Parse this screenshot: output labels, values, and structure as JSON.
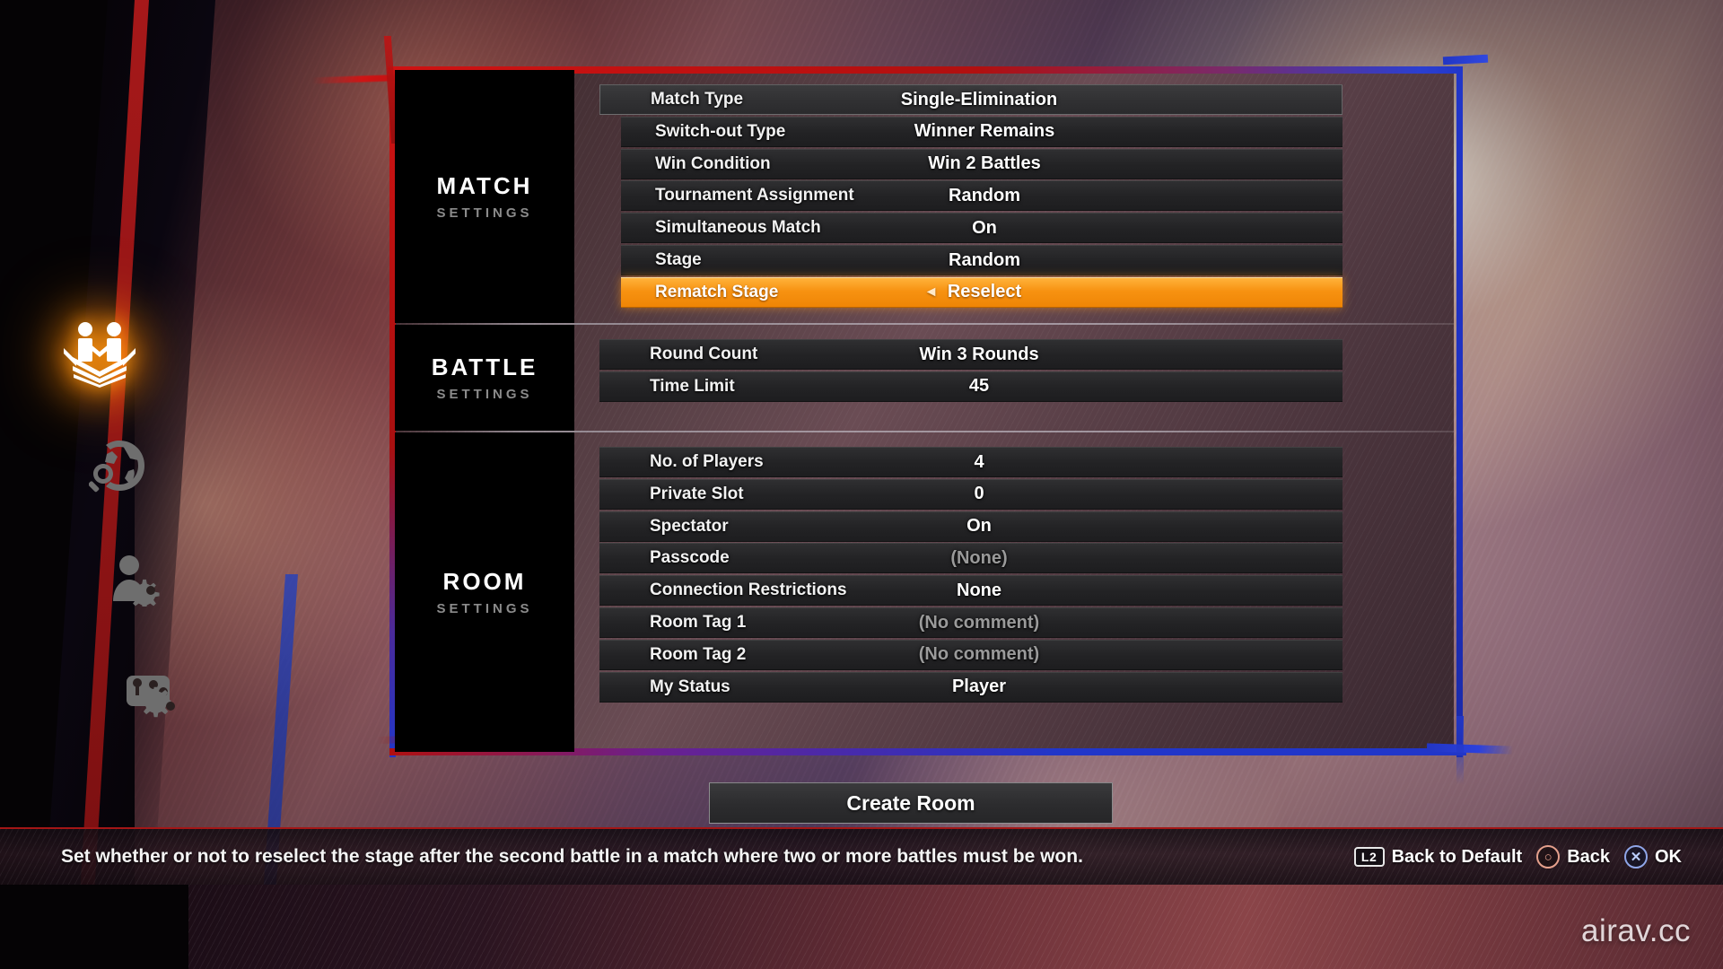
{
  "sidebar": {
    "items": [
      {
        "name": "create-room",
        "icon": "ring-room-icon",
        "active": true
      },
      {
        "name": "search-rooms",
        "icon": "globe-search-icon",
        "active": false
      },
      {
        "name": "player-settings",
        "icon": "player-gear-icon",
        "active": false
      },
      {
        "name": "controller-settings",
        "icon": "controller-gear-icon",
        "active": false
      }
    ]
  },
  "sections": [
    {
      "title": "MATCH",
      "subtitle": "SETTINGS",
      "rows": [
        {
          "label": "Match Type",
          "value": "Single-Elimination",
          "indent": false,
          "selected": false,
          "dim": false
        },
        {
          "label": "Switch-out Type",
          "value": "Winner Remains",
          "indent": true,
          "selected": false,
          "dim": false
        },
        {
          "label": "Win Condition",
          "value": "Win 2 Battles",
          "indent": true,
          "selected": false,
          "dim": false
        },
        {
          "label": "Tournament Assignment",
          "value": "Random",
          "indent": true,
          "selected": false,
          "dim": false
        },
        {
          "label": "Simultaneous Match",
          "value": "On",
          "indent": true,
          "selected": false,
          "dim": false
        },
        {
          "label": "Stage",
          "value": "Random",
          "indent": true,
          "selected": false,
          "dim": false
        },
        {
          "label": "Rematch Stage",
          "value": "Reselect",
          "indent": true,
          "selected": true,
          "dim": false,
          "arrow": "◄"
        }
      ]
    },
    {
      "title": "BATTLE",
      "subtitle": "SETTINGS",
      "rows": [
        {
          "label": "Round Count",
          "value": "Win 3 Rounds",
          "indent": false,
          "selected": false,
          "dim": false
        },
        {
          "label": "Time Limit",
          "value": "45",
          "indent": false,
          "selected": false,
          "dim": false
        }
      ]
    },
    {
      "title": "ROOM",
      "subtitle": "SETTINGS",
      "rows": [
        {
          "label": "No. of Players",
          "value": "4",
          "indent": false,
          "selected": false,
          "dim": false
        },
        {
          "label": "Private Slot",
          "value": "0",
          "indent": false,
          "selected": false,
          "dim": false
        },
        {
          "label": "Spectator",
          "value": "On",
          "indent": false,
          "selected": false,
          "dim": false
        },
        {
          "label": "Passcode",
          "value": "(None)",
          "indent": false,
          "selected": false,
          "dim": true
        },
        {
          "label": "Connection Restrictions",
          "value": "None",
          "indent": false,
          "selected": false,
          "dim": false
        },
        {
          "label": "Room Tag 1",
          "value": "(No comment)",
          "indent": false,
          "selected": false,
          "dim": true
        },
        {
          "label": "Room Tag 2",
          "value": "(No comment)",
          "indent": false,
          "selected": false,
          "dim": true
        },
        {
          "label": "My Status",
          "value": "Player",
          "indent": false,
          "selected": false,
          "dim": false
        }
      ]
    }
  ],
  "create_room_button": {
    "label": "Create Room"
  },
  "bottom_bar": {
    "hint": "Set whether or not to reselect the stage after the second battle in a match where two or more battles must be won.",
    "prompts": [
      {
        "key": "L2",
        "glyph": "l2-button",
        "label": "Back to Default"
      },
      {
        "key": "○",
        "glyph": "circle-button",
        "label": "Back"
      },
      {
        "key": "✕",
        "glyph": "cross-button",
        "label": "OK"
      }
    ]
  },
  "watermark": {
    "text": "airav.cc"
  },
  "colors": {
    "highlight": "#f79211",
    "frame_red": "#cf1212",
    "frame_blue": "#2136c9",
    "row_bg": "#232325",
    "dim_text": "#9a9a9a"
  }
}
